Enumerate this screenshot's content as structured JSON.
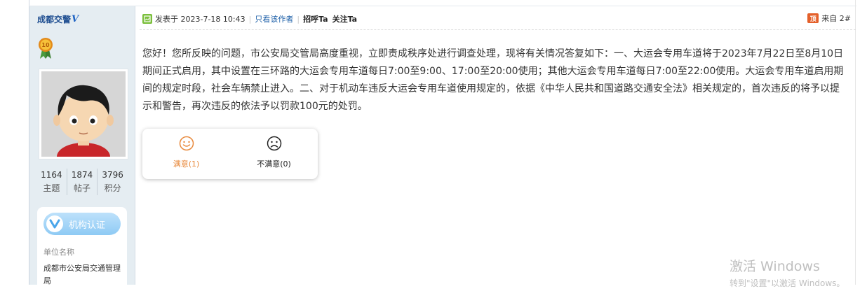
{
  "sidebar": {
    "username": "成都交警",
    "verified_mark": "V",
    "stats": [
      {
        "value": "1164",
        "label": "主题"
      },
      {
        "value": "1874",
        "label": "帖子"
      },
      {
        "value": "3796",
        "label": "积分"
      }
    ],
    "cert": {
      "label": "机构认证",
      "unit_title": "单位名称",
      "unit_name": "成都市公安局交通管理局"
    }
  },
  "post": {
    "posted_prefix": "发表于 2023-7-18 10:43",
    "only_author": "只看该作者",
    "greet": "招呼Ta",
    "follow": "关注Ta",
    "floor": "来自 2#",
    "floor_icon_text": "顶",
    "body": "您好！您所反映的问题，市公安局交管局高度重视，立即责成秩序处进行调查处理，现将有关情况答复如下：一、大运会专用车道将于2023年7月22日至8月10日期间正式启用，其中设置在三环路的大运会专用车道每日7:00至9:00、17:00至20:00使用；其他大运会专用车道每日7:00至22:00使用。大运会专用车道启用期间的规定时段，社会车辆禁止进入。二、对于机动车违反大运会专用车道使用规定的，依据《中华人民共和国道路交通安全法》相关规定的，首次违反的将予以提示和警告，再次违反的依法予以罚款100元的处罚。"
  },
  "rating": {
    "satisfied": "满意(1)",
    "unsatisfied": "不满意(0)"
  },
  "watermark": {
    "title": "激活 Windows",
    "subtitle": "转到\"设置\"以激活 Windows。"
  },
  "colors": {
    "sidebar_bg": "#e5edf2",
    "username": "#1b4b8f",
    "satisfied": "#e8893c",
    "floor_icon": "#e4602a"
  },
  "icons": {
    "post_icon": "post-green-icon",
    "medal": "medal-icon",
    "floor": "floor-icon",
    "happy": "smile-face-icon",
    "sad": "frown-face-icon"
  }
}
